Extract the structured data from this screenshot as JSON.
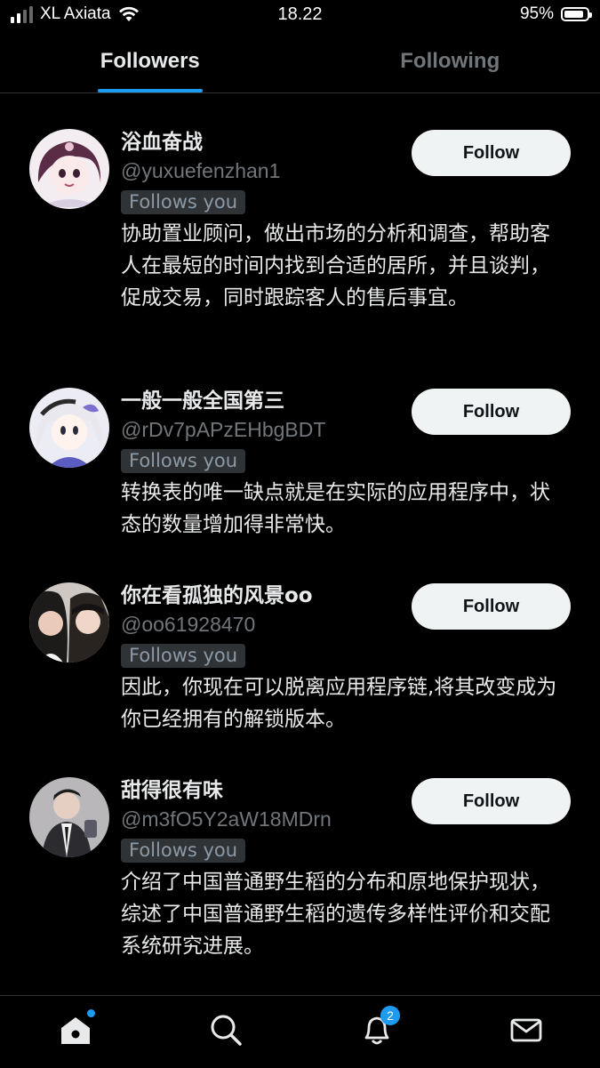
{
  "status_bar": {
    "carrier": "XL Axiata",
    "time": "18.22",
    "battery": "95%"
  },
  "tabs": [
    {
      "label": "Followers",
      "active": true
    },
    {
      "label": "Following",
      "active": false
    }
  ],
  "users": [
    {
      "name": "浴血奋战",
      "handle": "@yuxuefenzhan1",
      "follows_you": "Follows you",
      "bio": "协助置业顾问，做出市场的分析和调查，帮助客人在最短的时间内找到合适的居所，并且谈判，促成交易，同时跟踪客人的售后事宜。",
      "button": "Follow"
    },
    {
      "name": "一般一般全国第三",
      "handle": "@rDv7pAPzEHbgBDT",
      "follows_you": "Follows you",
      "bio": "转换表的唯一缺点就是在实际的应用程序中，状态的数量增加得非常快。",
      "button": "Follow"
    },
    {
      "name": "你在看孤独的风景oo",
      "handle": "@oo61928470",
      "follows_you": "Follows you",
      "bio": "因此，你现在可以脱离应用程序链,将其改变成为你已经拥有的解锁版本。",
      "button": "Follow"
    },
    {
      "name": "甜得很有味",
      "handle": "@m3fO5Y2aW18MDrn",
      "follows_you": "Follows you",
      "bio": "介绍了中国普通野生稻的分布和原地保护现状，综述了中国普通野生稻的遗传多样性评价和交配系统研究进展。",
      "button": "Follow"
    }
  ],
  "bottom_nav": {
    "items": [
      "home-icon",
      "search-icon",
      "bell-icon",
      "mail-icon"
    ],
    "notifications_badge": "2"
  },
  "colors": {
    "accent": "#1d9bf0",
    "background": "#000000",
    "muted": "#71767b",
    "button_bg": "#eff3f4"
  }
}
